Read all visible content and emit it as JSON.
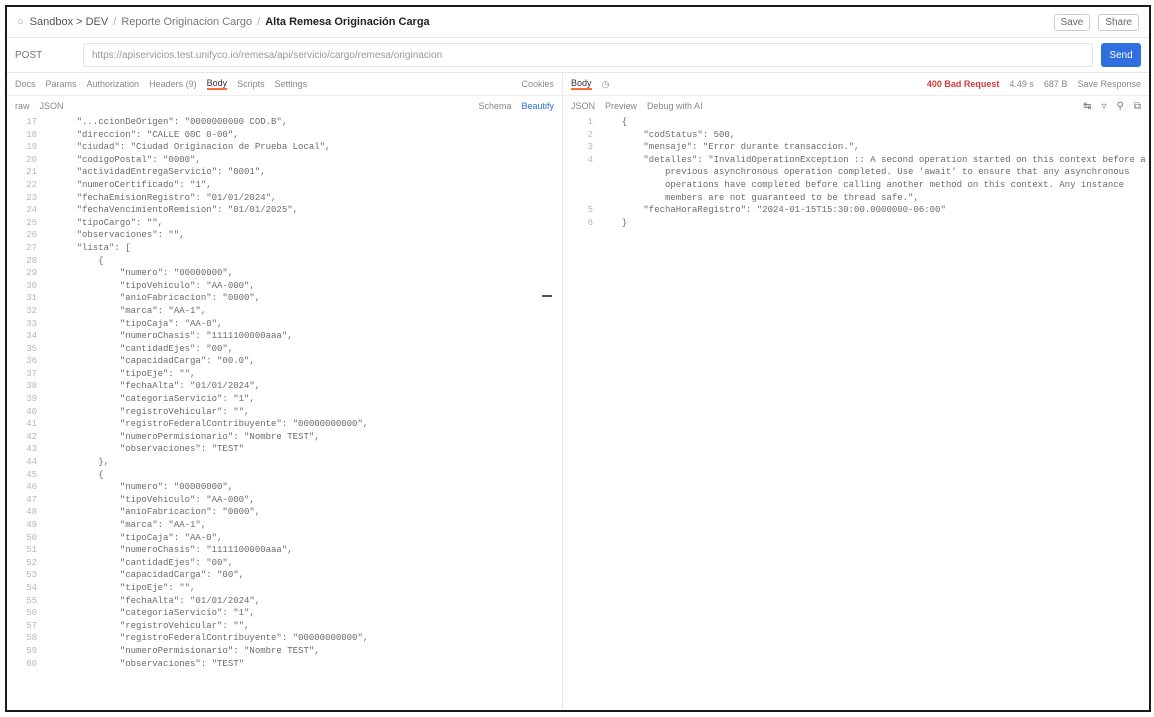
{
  "header": {
    "workspace": "Sandbox > DEV",
    "collection": "Reporte Originacion Cargo",
    "current": "Alta Remesa Originación Carga",
    "save_label": "Save",
    "share_label": "Share"
  },
  "request": {
    "method": "POST",
    "url": "https://apiservicios.test.unifyco.io/remesa/api/servicio/cargo/remesa/originacion",
    "send_label": "Send"
  },
  "left_tabs": [
    "Docs",
    "Params",
    "Authorization",
    "Headers (9)",
    "Body",
    "Scripts",
    "Settings"
  ],
  "left_cookies": "Cookies",
  "left_subtabs": {
    "type": "raw",
    "format": "JSON",
    "beautify": "Beautify",
    "schema": "Schema"
  },
  "right_header": {
    "label": "Body",
    "status": "400 Bad Request",
    "time": "4.49 s",
    "size": "687 B",
    "save_response": "Save Response"
  },
  "right_subtabs": {
    "format": "JSON",
    "preview": "Preview",
    "visualize": "Debug with AI"
  },
  "left_code": [
    {
      "n": "17",
      "t": "    \"...ccionDeOrigen\": \"0000000000 COD.B\","
    },
    {
      "n": "18",
      "t": "    \"direccion\": \"CALLE 00C 0-00\","
    },
    {
      "n": "19",
      "t": "    \"ciudad\": \"Ciudad Originacion de Prueba Local\","
    },
    {
      "n": "20",
      "t": "    \"codigoPostal\": \"0000\","
    },
    {
      "n": "21",
      "t": "    \"actividadEntregaServicio\": \"0001\","
    },
    {
      "n": "22",
      "t": "    \"numeroCertificado\": \"1\","
    },
    {
      "n": "23",
      "t": "    \"fechaEmisionRegistro\": \"01/01/2024\","
    },
    {
      "n": "24",
      "t": "    \"fechaVencimientoRemision\": \"01/01/2025\","
    },
    {
      "n": "25",
      "t": "    \"tipoCargo\": \"\","
    },
    {
      "n": "26",
      "t": "    \"observaciones\": \"\","
    },
    {
      "n": "27",
      "t": "    \"lista\": ["
    },
    {
      "n": "28",
      "t": "        {"
    },
    {
      "n": "29",
      "t": "            \"numero\": \"00000000\","
    },
    {
      "n": "30",
      "t": "            \"tipoVehiculo\": \"AA-000\","
    },
    {
      "n": "31",
      "t": "            \"anioFabricacion\": \"0000\","
    },
    {
      "n": "32",
      "t": "            \"marca\": \"AA-1\","
    },
    {
      "n": "33",
      "t": "            \"tipoCaja\": \"AA-0\","
    },
    {
      "n": "34",
      "t": "            \"numeroChasis\": \"1111100000aaa\","
    },
    {
      "n": "35",
      "t": "            \"cantidadEjes\": \"00\","
    },
    {
      "n": "36",
      "t": "            \"capacidadCarga\": \"00.0\","
    },
    {
      "n": "37",
      "t": "            \"tipoEje\": \"\","
    },
    {
      "n": "38",
      "t": "            \"fechaAlta\": \"01/01/2024\","
    },
    {
      "n": "39",
      "t": "            \"categoriaServicio\": \"1\","
    },
    {
      "n": "40",
      "t": "            \"registroVehicular\": \"\","
    },
    {
      "n": "41",
      "t": "            \"registroFederalContribuyente\": \"00000000000\","
    },
    {
      "n": "42",
      "t": "            \"numeroPermisionario\": \"Nombre TEST\","
    },
    {
      "n": "43",
      "t": "            \"observaciones\": \"TEST\""
    },
    {
      "n": "44",
      "t": "        },"
    },
    {
      "n": "45",
      "t": "        {"
    },
    {
      "n": "46",
      "t": "            \"numero\": \"00000000\","
    },
    {
      "n": "47",
      "t": "            \"tipoVehiculo\": \"AA-000\","
    },
    {
      "n": "48",
      "t": "            \"anioFabricacion\": \"0000\","
    },
    {
      "n": "49",
      "t": "            \"marca\": \"AA-1\","
    },
    {
      "n": "50",
      "t": "            \"tipoCaja\": \"AA-0\","
    },
    {
      "n": "51",
      "t": "            \"numeroChasis\": \"1111100000aaa\","
    },
    {
      "n": "52",
      "t": "            \"cantidadEjes\": \"00\","
    },
    {
      "n": "53",
      "t": "            \"capacidadCarga\": \"00\","
    },
    {
      "n": "54",
      "t": "            \"tipoEje\": \"\","
    },
    {
      "n": "55",
      "t": "            \"fechaAlta\": \"01/01/2024\","
    },
    {
      "n": "56",
      "t": "            \"categoriaServicio\": \"1\","
    },
    {
      "n": "57",
      "t": "            \"registroVehicular\": \"\","
    },
    {
      "n": "58",
      "t": "            \"registroFederalContribuyente\": \"00000000000\","
    },
    {
      "n": "59",
      "t": "            \"numeroPermisionario\": \"Nombre TEST\","
    },
    {
      "n": "60",
      "t": "            \"observaciones\": \"TEST\""
    }
  ],
  "right_code": [
    {
      "n": "1",
      "t": "  {"
    },
    {
      "n": "2",
      "t": "      \"codStatus\": 500,"
    },
    {
      "n": "3",
      "t": "      \"mensaje\": \"Error durante transaccion.\","
    },
    {
      "n": "4",
      "t": "      \"detalles\": \"InvalidOperationException :: A second operation started on this context before a"
    },
    {
      "n": "",
      "t": "          previous asynchronous operation completed. Use 'await' to ensure that any asynchronous"
    },
    {
      "n": "",
      "t": "          operations have completed before calling another method on this context. Any instance"
    },
    {
      "n": "",
      "t": "          members are not guaranteed to be thread safe.\","
    },
    {
      "n": "5",
      "t": "      \"fechaHoraRegistro\": \"2024-01-15T15:30:00.0000000-06:00\""
    },
    {
      "n": "6",
      "t": "  }"
    }
  ],
  "colors": {
    "accent": "#ff6c37",
    "send": "#2f6fdf",
    "error": "#d23b3b"
  }
}
